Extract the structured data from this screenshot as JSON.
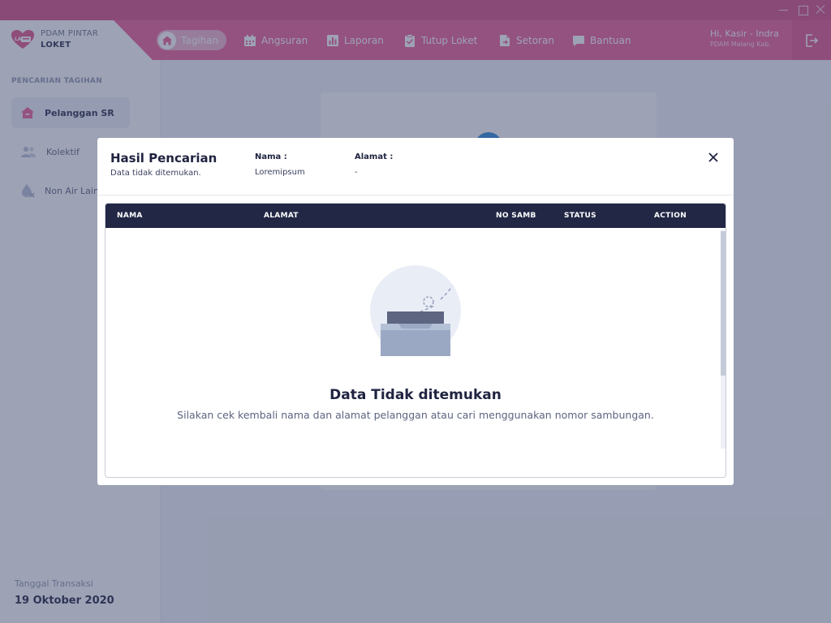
{
  "window": {
    "controls": [
      "minimize",
      "maximize",
      "close"
    ]
  },
  "brand": {
    "line1": "PDAM PINTAR",
    "line2": "LOKET",
    "logo_text": "LA"
  },
  "nav": {
    "items": [
      {
        "label": "Tagihan",
        "icon": "home-icon",
        "active": true
      },
      {
        "label": "Angsuran",
        "icon": "calendar-icon"
      },
      {
        "label": "Laporan",
        "icon": "chart-icon"
      },
      {
        "label": "Tutup Loket",
        "icon": "clipboard-check-icon"
      },
      {
        "label": "Setoran",
        "icon": "document-arrow-icon"
      },
      {
        "label": "Bantuan",
        "icon": "chat-icon"
      }
    ]
  },
  "user": {
    "greeting": "Hi, Kasir - Indra",
    "org": "PDAM Malang Kab."
  },
  "sidebar": {
    "heading": "PENCARIAN TAGIHAN",
    "items": [
      {
        "label": "Pelanggan SR",
        "icon": "house-icon",
        "active": true
      },
      {
        "label": "Kolektif",
        "icon": "users-icon"
      },
      {
        "label": "Non Air Lain",
        "icon": "water-drop-off-icon"
      }
    ],
    "date_label": "Tanggal Transaksi",
    "date_value": "19 Oktober 2020"
  },
  "modal": {
    "title": "Hasil Pencarian",
    "subtitle": "Data tidak ditemukan.",
    "nama_label": "Nama :",
    "nama_value": "Loremipsum",
    "alamat_label": "Alamat :",
    "alamat_value": "-",
    "table": {
      "columns": [
        "NAMA",
        "ALAMAT",
        "NO SAMB",
        "STATUS",
        "ACTION"
      ]
    },
    "empty": {
      "title": "Data Tidak ditemukan",
      "description": "Silakan cek kembali nama dan alamat pelanggan atau cari menggunakan nomor sambungan."
    }
  },
  "colors": {
    "brand_pink": "#ec5f97",
    "titlebar_pink": "#d64f86",
    "header_dark": "#222745",
    "accent_blue": "#2b88d8"
  }
}
